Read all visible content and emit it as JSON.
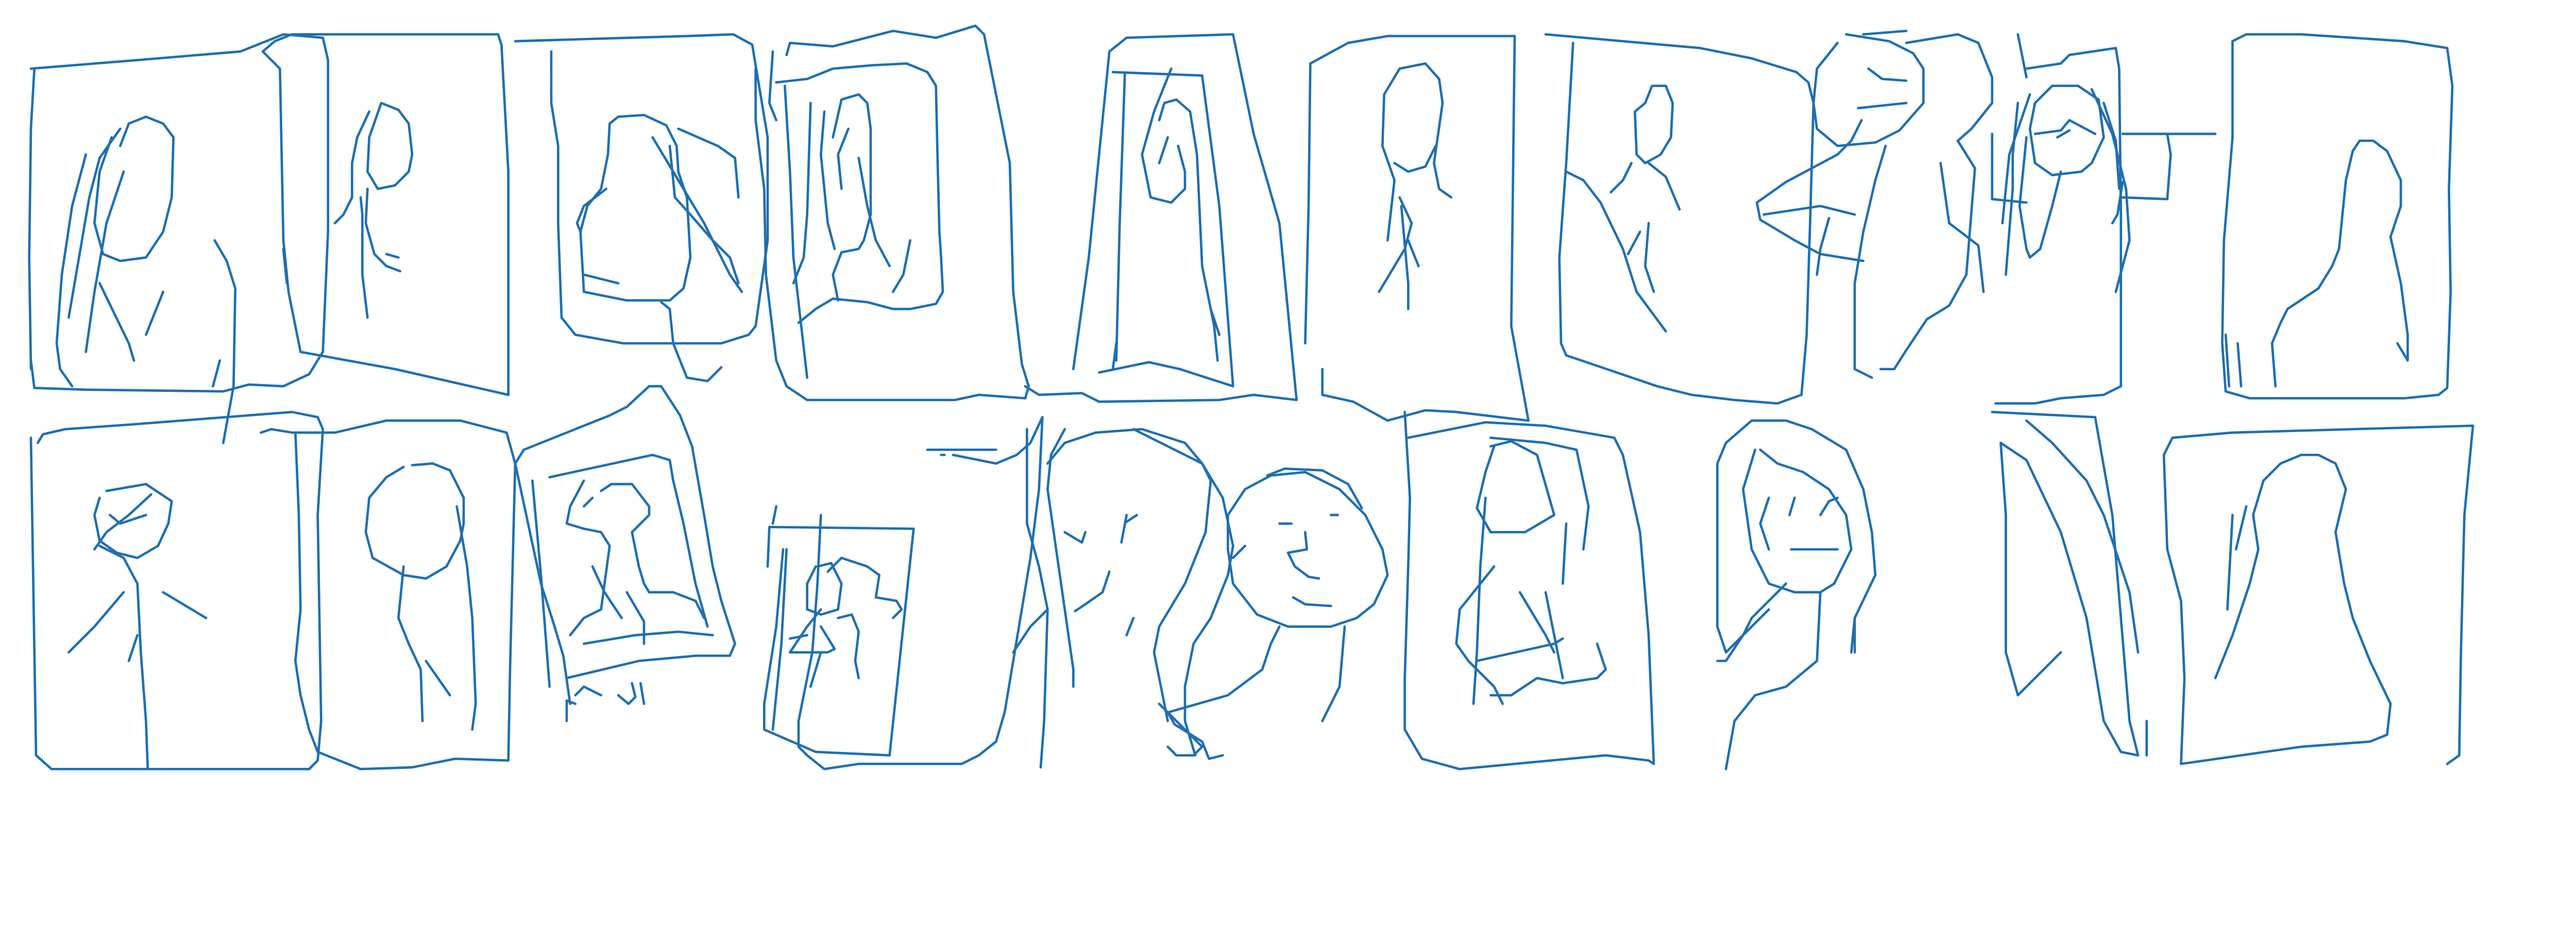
{
  "title": "",
  "stroke_color": "#1f6fb0",
  "background_color": "#ffffff",
  "grid": {
    "rows": 2,
    "columns": 10
  },
  "sketches": [
    {
      "subject": "portrait"
    },
    {
      "subject": "portrait"
    },
    {
      "subject": "portrait"
    },
    {
      "subject": "portrait"
    },
    {
      "subject": "portrait"
    },
    {
      "subject": "portrait"
    },
    {
      "subject": "portrait"
    },
    {
      "subject": "portrait"
    },
    {
      "subject": "portrait"
    },
    {
      "subject": "portrait"
    },
    {
      "subject": "portrait"
    },
    {
      "subject": "portrait"
    },
    {
      "subject": "portrait"
    },
    {
      "subject": "portrait"
    },
    {
      "subject": "portrait"
    },
    {
      "subject": "portrait"
    },
    {
      "subject": "portrait"
    },
    {
      "subject": "portrait"
    },
    {
      "subject": "portrait"
    },
    {
      "subject": "portrait"
    }
  ]
}
